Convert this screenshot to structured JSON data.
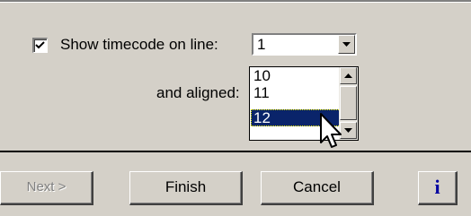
{
  "timecode": {
    "checkbox_checked": true,
    "label": "Show timecode on line:",
    "selected_value": "1"
  },
  "aligned": {
    "label": "and aligned:",
    "list_items": [
      "10",
      "11",
      "12"
    ],
    "highlighted_item": "12"
  },
  "footer": {
    "next_label": "Next >",
    "finish_label": "Finish",
    "cancel_label": "Cancel",
    "info_label": "i"
  },
  "colors": {
    "face": "#d4d0c8",
    "selection": "#0a246a",
    "info_text": "#0000a0"
  },
  "icons": {
    "checkbox": "checkmark-icon",
    "combo_button": "chevron-down-icon",
    "scroll_up": "arrow-up-icon",
    "scroll_down": "arrow-down-icon",
    "cursor": "mouse-pointer-icon"
  }
}
